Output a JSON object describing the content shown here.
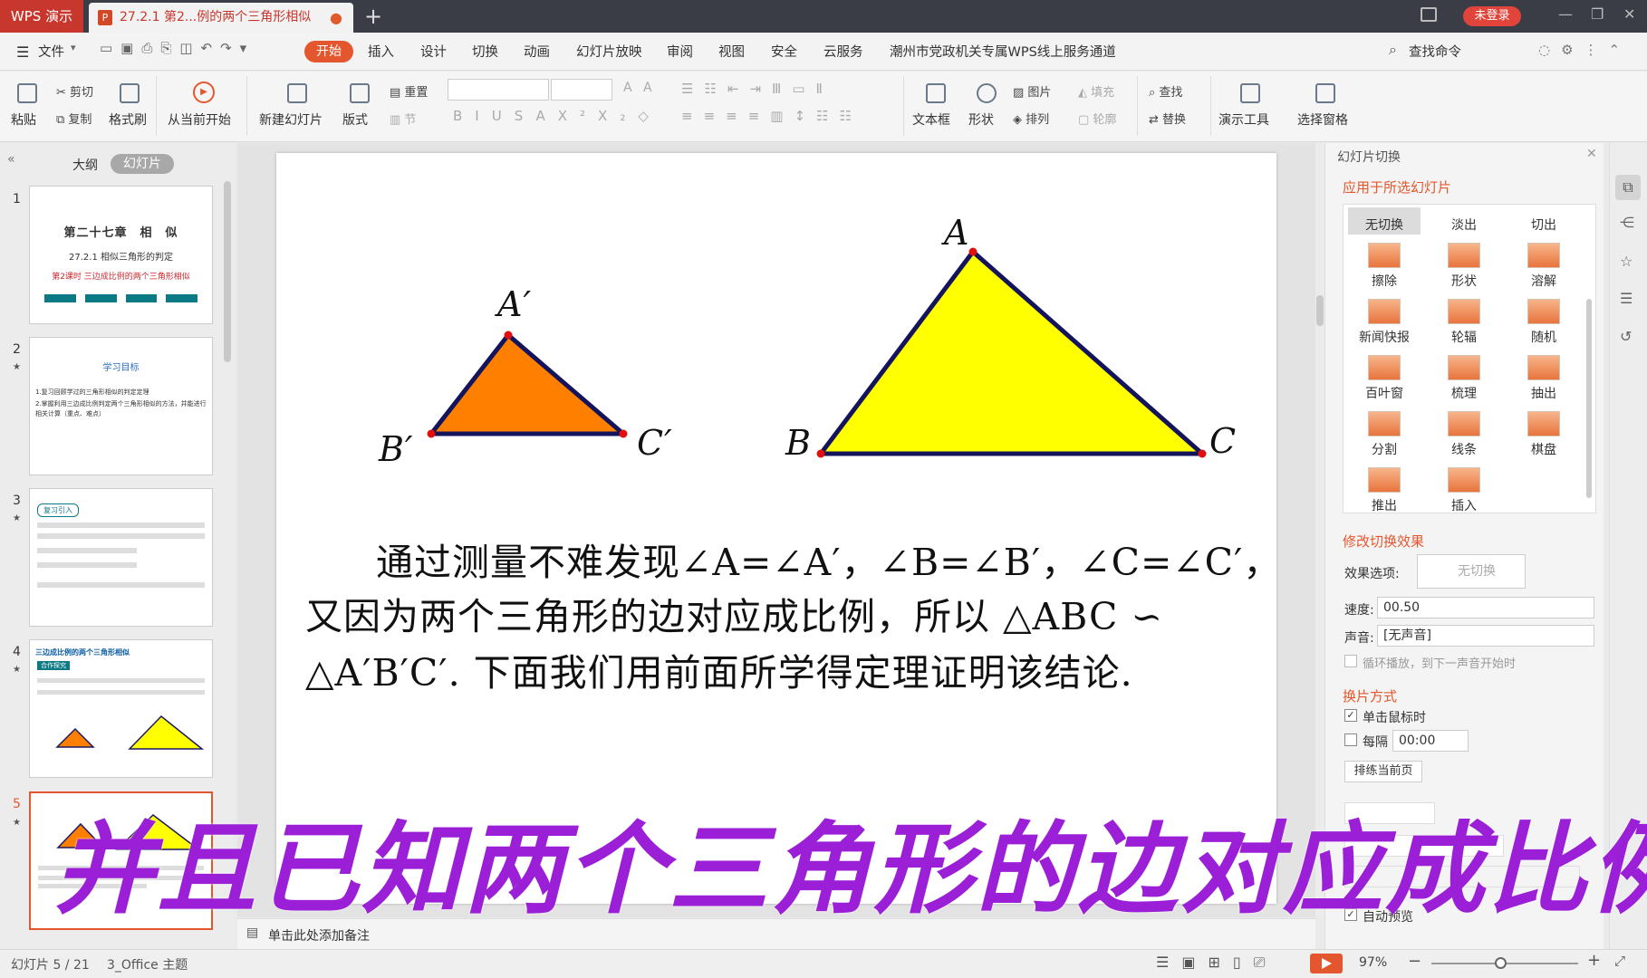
{
  "titlebar": {
    "app_tab": "WPS 演示",
    "doc_tab": "27.2.1 第2...例的两个三角形相似",
    "new_tab": "+",
    "login": "未登录"
  },
  "menu": {
    "file": "文件",
    "items": [
      "开始",
      "插入",
      "设计",
      "切换",
      "动画",
      "幻灯片放映",
      "审阅",
      "视图",
      "安全",
      "云服务",
      "潮州市党政机关专属WPS线上服务通道"
    ],
    "search": "查找命令"
  },
  "ribbon": {
    "paste": "粘贴",
    "cut": "剪切",
    "copy": "复制",
    "format_painter": "格式刷",
    "from_current": "从当前开始",
    "new_slide": "新建幻灯片",
    "layout": "版式",
    "reset": "重置",
    "section": "节",
    "textbox": "文本框",
    "shape": "形状",
    "picture": "图片",
    "arrange": "排列",
    "fill": "填充",
    "outline": "轮廓",
    "find": "查找",
    "replace": "替换",
    "present_tools": "演示工具",
    "select_pane": "选择窗格"
  },
  "leftpanel": {
    "tab_outline": "大纲",
    "tab_slides": "幻灯片"
  },
  "thumbs": {
    "t1": {
      "num": "1",
      "title": "第二十七章　相　似",
      "sub": "27.2.1 相似三角形的判定",
      "sub2": "第2课时 三边成比例的两个三角形相似"
    },
    "t2": {
      "num": "2",
      "title": "学习目标",
      "l1": "1.复习回顾学过的三角形相似的判定定理",
      "l2": "2.掌握利用三边成比例判定两个三角形相似的方法，并能进行相关计算（重点、难点）"
    },
    "t3": {
      "num": "3",
      "head": "复习引入"
    },
    "t4": {
      "num": "4",
      "head": "三边成比例的两个三角形相似",
      "tag": "合作探究"
    },
    "t5": {
      "num": "5"
    }
  },
  "slide": {
    "labels": {
      "A": "A",
      "B": "B",
      "C": "C",
      "A1": "A′",
      "B1": "B′",
      "C1": "C′"
    },
    "line1": "通过测量不难发现∠A=∠A′，∠B=∠B′，∠C=∠C′，",
    "line2": "又因为两个三角形的边对应成比例，所以 △ABC ∽",
    "line3": "△A′B′C′. 下面我们用前面所学得定理证明该结论."
  },
  "subtitle": "并且已知两个三角形的边对应成比例",
  "rightpanel": {
    "title": "幻灯片切换",
    "apply": "应用于所选幻灯片",
    "effects": [
      "无切换",
      "淡出",
      "切出",
      "擦除",
      "形状",
      "溶解",
      "新闻快报",
      "轮辐",
      "随机",
      "百叶窗",
      "梳理",
      "抽出",
      "分割",
      "线条",
      "棋盘",
      "推出",
      "插入"
    ],
    "modify": "修改切换效果",
    "effect_option_label": "效果选项:",
    "effect_option_value": "无切换",
    "speed_label": "速度:",
    "speed_value": "00.50",
    "sound_label": "声音:",
    "sound_value": "[无声音]",
    "loop": "循环播放，到下一声音开始时",
    "switch_mode": "换片方式",
    "on_click": "单击鼠标时",
    "every": "每隔",
    "every_value": "00:00",
    "rehearse": "排练当前页",
    "auto_preview": "自动预览"
  },
  "notes": "单击此处添加备注",
  "status": {
    "slide_pos": "幻灯片 5 / 21",
    "theme": "3_Office 主题",
    "zoom": "97%"
  },
  "colors": {
    "accent": "#e4572e",
    "small_tri": "#ff8000",
    "big_tri": "#ffff00",
    "subtitle": "#9a1fd6"
  }
}
